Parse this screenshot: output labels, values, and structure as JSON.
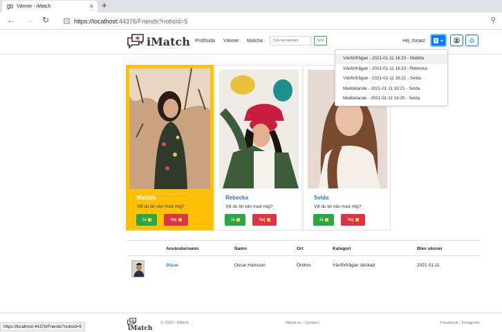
{
  "browser": {
    "tab_title": "Vänner - iMatch",
    "tab_close": "×",
    "new_tab": "+",
    "url_host": "https://localhost",
    "url_rest": ":44376/Friends?notisId=5",
    "status_url": "https://localhost:44376/Friends?notisId=5"
  },
  "nav": {
    "brand": "iMatch",
    "links": [
      "Profilsida",
      "Vänner",
      "Matcha"
    ],
    "search_placeholder": "Sök användare",
    "search_button": "Sök",
    "greeting": "Hej Jonas!"
  },
  "notifications": [
    "Vänförfrågan - 2021-01-11 16:23 - Matilda",
    "Vänförfrågan - 2021-01-11 16:23 - Rebecka",
    "Vänförfrågan - 2021-01-11 16:21 - Selda",
    "Meddelande - 2021-01-11 16:21 - Selda",
    "Meddelande - 2021-01-11 16:20 - Selda"
  ],
  "requests": [
    {
      "name": "Matilda",
      "question": "Vill du bli vän med mig?",
      "yes": "Ja",
      "no": "Nej"
    },
    {
      "name": "Rebecka",
      "question": "Vill du bli vän med mig?",
      "yes": "Ja",
      "no": "Nej"
    },
    {
      "name": "Selda",
      "question": "Vill du bli vän med mig?",
      "yes": "Ja",
      "no": "Nej"
    }
  ],
  "friends_table": {
    "headers": [
      "Användarnamn",
      "Namn",
      "Ort",
      "Kategori",
      "Blev vänner"
    ],
    "rows": [
      {
        "username": "Oscar",
        "name": "Oscar Hansson",
        "city": "Örebro",
        "category": "Vänförfrågan skickad",
        "since": "2021-01-11"
      }
    ]
  },
  "footer": {
    "brand": "iMatch",
    "copyright": "© 2020 - iMatch",
    "middle": "About us - Contact",
    "right": "Facebook - Instagram"
  },
  "colors": {
    "selected_card": "#ffc107",
    "primary": "#007bff",
    "yes_button": "#28a745",
    "no_button": "#dc3545",
    "link": "#2a73c5"
  }
}
